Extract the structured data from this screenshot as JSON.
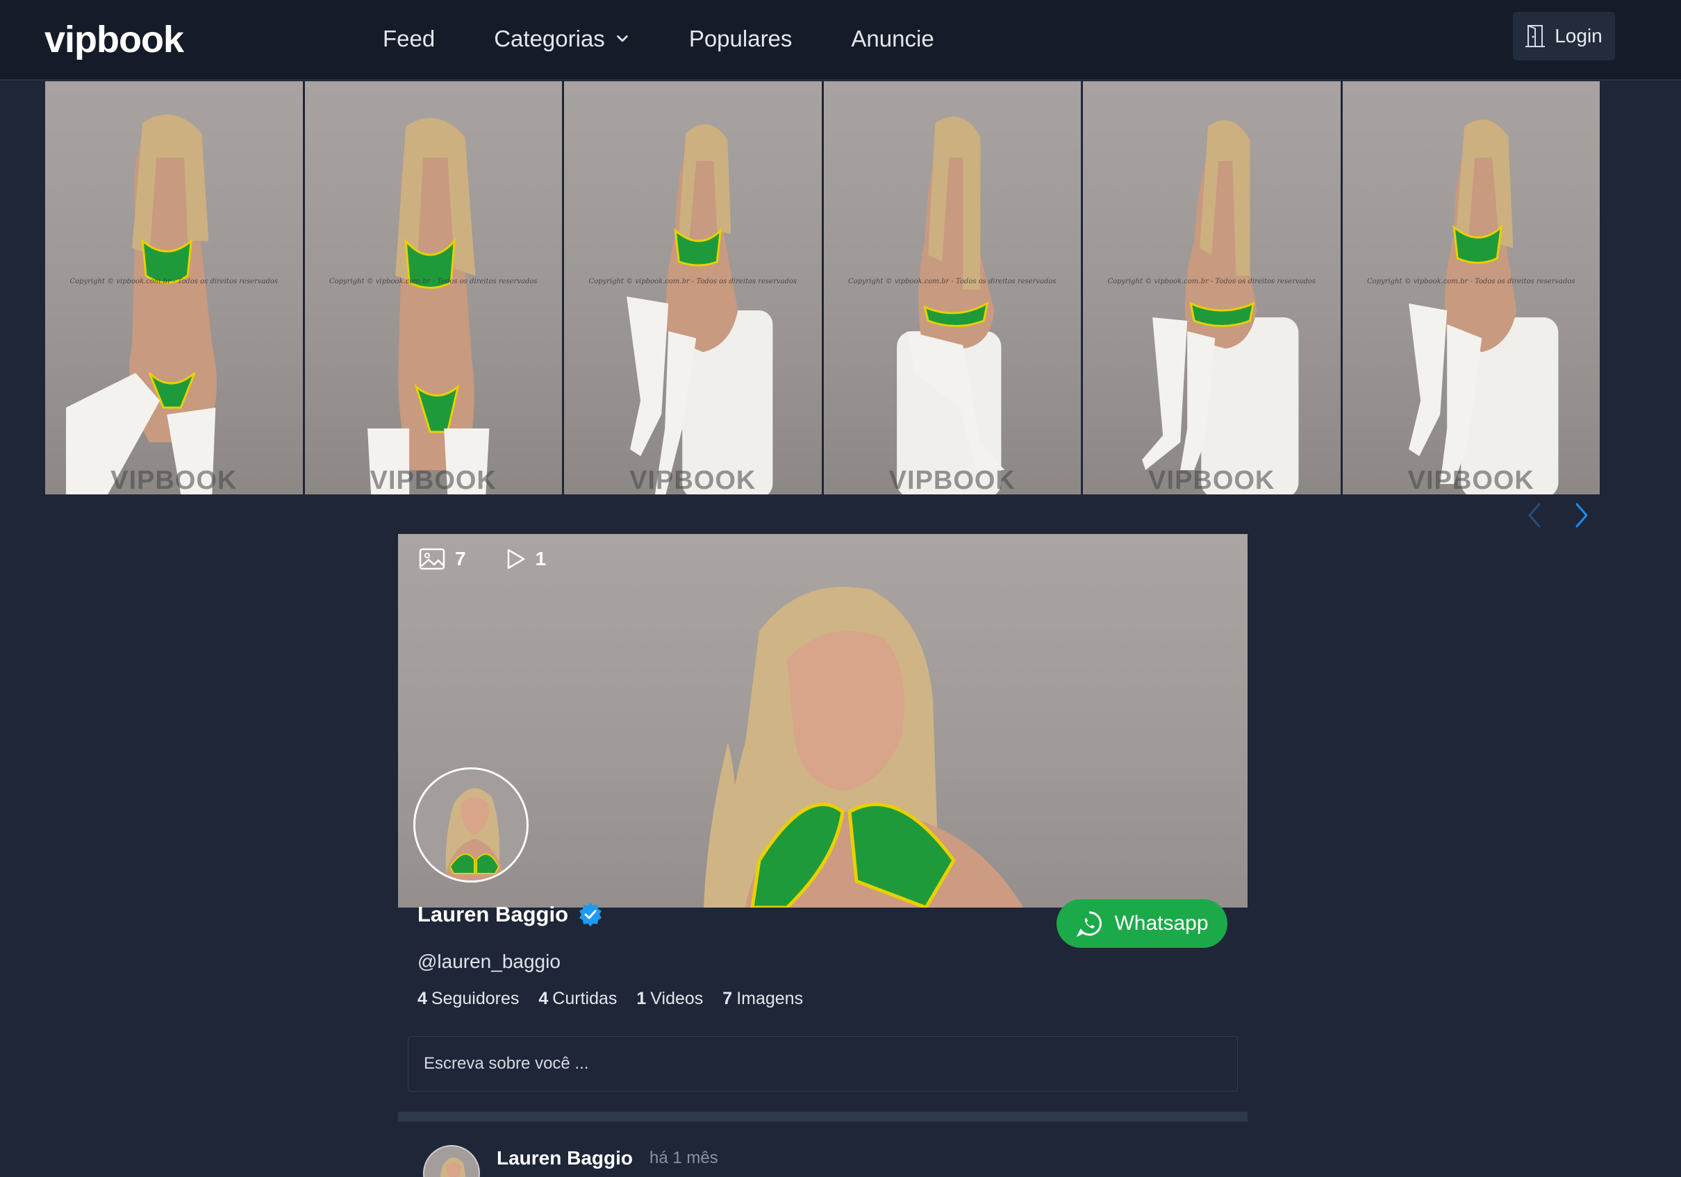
{
  "header": {
    "logo": "vipbook",
    "nav": [
      {
        "label": "Feed"
      },
      {
        "label": "Categorias"
      },
      {
        "label": "Populares"
      },
      {
        "label": "Anuncie"
      }
    ],
    "login_label": "Login"
  },
  "gallery": {
    "photos": [
      {
        "copyright": "Copyright © vipbook.com.br - Todos os direitos reservados",
        "watermark": "VIPBOOK"
      },
      {
        "copyright": "Copyright © vipbook.com.br - Todos os direitos reservados",
        "watermark": "VIPBOOK"
      },
      {
        "copyright": "Copyright © vipbook.com.br - Todos os direitos reservados",
        "watermark": "VIPBOOK"
      },
      {
        "copyright": "Copyright © vipbook.com.br - Todos os direitos reservados",
        "watermark": "VIPBOOK"
      },
      {
        "copyright": "Copyright © vipbook.com.br - Todos os direitos reservados",
        "watermark": "VIPBOOK"
      },
      {
        "copyright": "Copyright © vipbook.com.br - Todos os direitos reservados",
        "watermark": "VIPBOOK"
      }
    ]
  },
  "profile": {
    "image_count": "7",
    "video_count": "1",
    "name": "Lauren Baggio",
    "handle": "@lauren_baggio",
    "stats": [
      {
        "value": "4",
        "label": "Seguidores"
      },
      {
        "value": "4",
        "label": "Curtidas"
      },
      {
        "value": "1",
        "label": "Videos"
      },
      {
        "value": "7",
        "label": "Imagens"
      }
    ],
    "whatsapp_label": "Whatsapp",
    "about_placeholder": "Escreva sobre você ..."
  },
  "post": {
    "author": "Lauren Baggio",
    "time": "há 1 mês"
  },
  "colors": {
    "background": "#1e2637",
    "topbar": "#151b28",
    "whatsapp": "#1ca94a",
    "verified": "#1d9bf0",
    "arrow": "#1d8cf0"
  }
}
